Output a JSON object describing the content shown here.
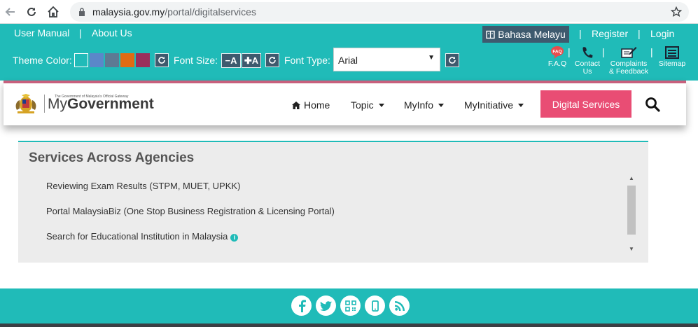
{
  "browser": {
    "url_host": "malaysia.gov.my",
    "url_path": "/portal/digitalservices"
  },
  "topbar": {
    "user_manual": "User Manual",
    "about_us": "About Us",
    "separator": "|",
    "language": "Bahasa Melayu",
    "register": "Register",
    "login": "Login"
  },
  "tools": {
    "theme_color_label": "Theme Color:",
    "theme_colors": [
      "#20bbb8",
      "#5b87c9",
      "#5d7a93",
      "#e06b12",
      "#9a2f5c"
    ],
    "font_size_label": "Font Size:",
    "font_decrease": "−A",
    "font_increase": "✚A",
    "font_type_label": "Font Type:",
    "font_type_value": "Arial"
  },
  "utilities": {
    "faq": "F.A.Q",
    "contact_line1": "Contact",
    "contact_line2": "Us",
    "complaints_line1": "Complaints",
    "complaints_line2": "& Feedback",
    "sitemap": "Sitemap"
  },
  "header": {
    "logo_tagline": "The Government of Malaysia's Official Gateway",
    "logo_my": "My",
    "logo_government": "Government",
    "menu": {
      "home": "Home",
      "topic": "Topic",
      "myinfo": "MyInfo",
      "myinitiative": "MyInitiative"
    },
    "digital_services": "Digital Services"
  },
  "main": {
    "title": "Services Across Agencies",
    "services": [
      "Reviewing Exam Results (STPM, MUET, UPKK)",
      "Portal MalaysiaBiz (One Stop Business Registration & Licensing Portal)",
      "Search for Educational Institution in Malaysia"
    ]
  },
  "colors": {
    "teal": "#20bbb8",
    "dark_slate": "#3e5a6e",
    "accent_pink": "#e94d74",
    "header_border": "#c8607d"
  },
  "icons": [
    "back-arrow-icon",
    "reload-icon",
    "home-icon",
    "lock-icon",
    "star-icon",
    "book-icon",
    "refresh-icon",
    "faq-icon",
    "phone-icon",
    "complaint-icon",
    "sitemap-icon",
    "search-icon",
    "info-icon",
    "facebook-icon",
    "twitter-icon",
    "qr-code-icon",
    "mobile-icon",
    "rss-icon"
  ]
}
